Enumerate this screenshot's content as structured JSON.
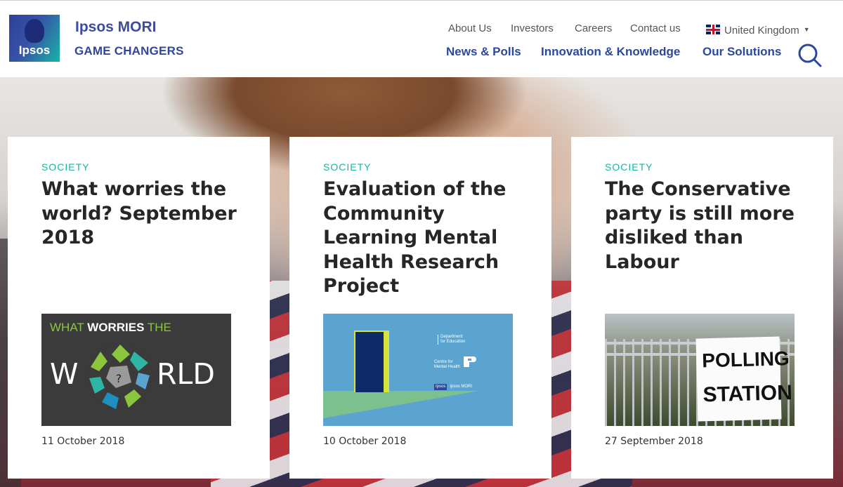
{
  "brand": {
    "logo_text": "Ipsos",
    "name": "Ipsos MORI",
    "tagline": "GAME CHANGERS"
  },
  "utility_nav": [
    {
      "label": "About Us"
    },
    {
      "label": "Investors"
    },
    {
      "label": "Careers"
    },
    {
      "label": "Contact us"
    }
  ],
  "language": {
    "label": "United Kingdom"
  },
  "main_nav": [
    {
      "label": "News & Polls"
    },
    {
      "label": "Innovation & Knowledge"
    },
    {
      "label": "Our Solutions"
    }
  ],
  "cards": [
    {
      "category": "SOCIETY",
      "title": "What worries the world? September 2018",
      "date": "11 October 2018",
      "image": {
        "heading_light": "WHAT ",
        "heading_bold": "WORRIES",
        "heading_end": " THE",
        "word_left": "W",
        "word_right": "RLD"
      }
    },
    {
      "category": "SOCIETY",
      "title": "Evaluation of the Community Learning Mental Health Research Project",
      "date": "10 October 2018",
      "image": {
        "dept_line1": "Department",
        "dept_line2": "for Education",
        "cmh_line1": "Centre for",
        "cmh_line2": "Mental Health",
        "ipsos_mark": "Ipsos",
        "ipsos_text": "Ipsos MORI"
      }
    },
    {
      "category": "SOCIETY",
      "title": "The Conservative party is still more disliked than Labour",
      "date": "27 September 2018",
      "image": {
        "sign_line1": "POLLING",
        "sign_line2": "STATION"
      }
    }
  ],
  "colors": {
    "brand_blue": "#2a48a0",
    "accent_teal": "#1ab4a5",
    "text_dark": "#262626"
  }
}
